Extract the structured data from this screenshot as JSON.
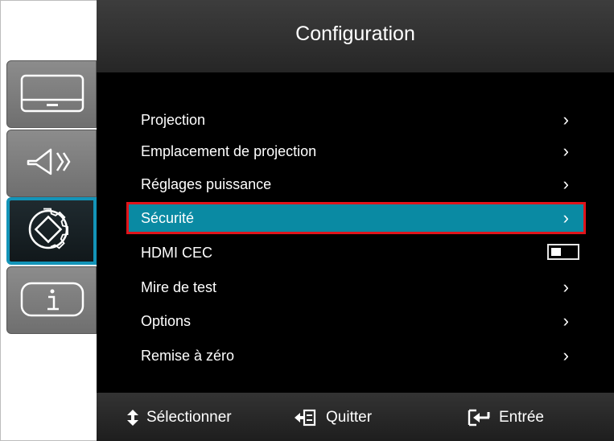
{
  "title": "Configuration",
  "sidebar": {
    "tabs": [
      {
        "icon": "display-icon",
        "active": false
      },
      {
        "icon": "audio-icon",
        "active": false
      },
      {
        "icon": "settings-gear-icon",
        "active": true
      },
      {
        "icon": "info-icon",
        "active": false
      }
    ]
  },
  "menu": {
    "items": [
      {
        "label": "Projection",
        "control": "chevron"
      },
      {
        "label": "Emplacement de projection",
        "control": "chevron"
      },
      {
        "label": "Réglages puissance",
        "control": "chevron"
      },
      {
        "label": "Sécurité",
        "control": "chevron",
        "selected": true
      },
      {
        "label": "HDMI CEC",
        "control": "toggle",
        "toggle_state": "off"
      },
      {
        "label": "Mire de test",
        "control": "chevron"
      },
      {
        "label": "Options",
        "control": "chevron"
      },
      {
        "label": "Remise à zéro",
        "control": "chevron"
      }
    ]
  },
  "footer": {
    "select_label": "Sélectionner",
    "quit_label": "Quitter",
    "enter_label": "Entrée"
  },
  "colors": {
    "selected_bg": "#0a8aa3",
    "selection_border": "#e0141b",
    "active_tab_border": "#1394b8"
  }
}
